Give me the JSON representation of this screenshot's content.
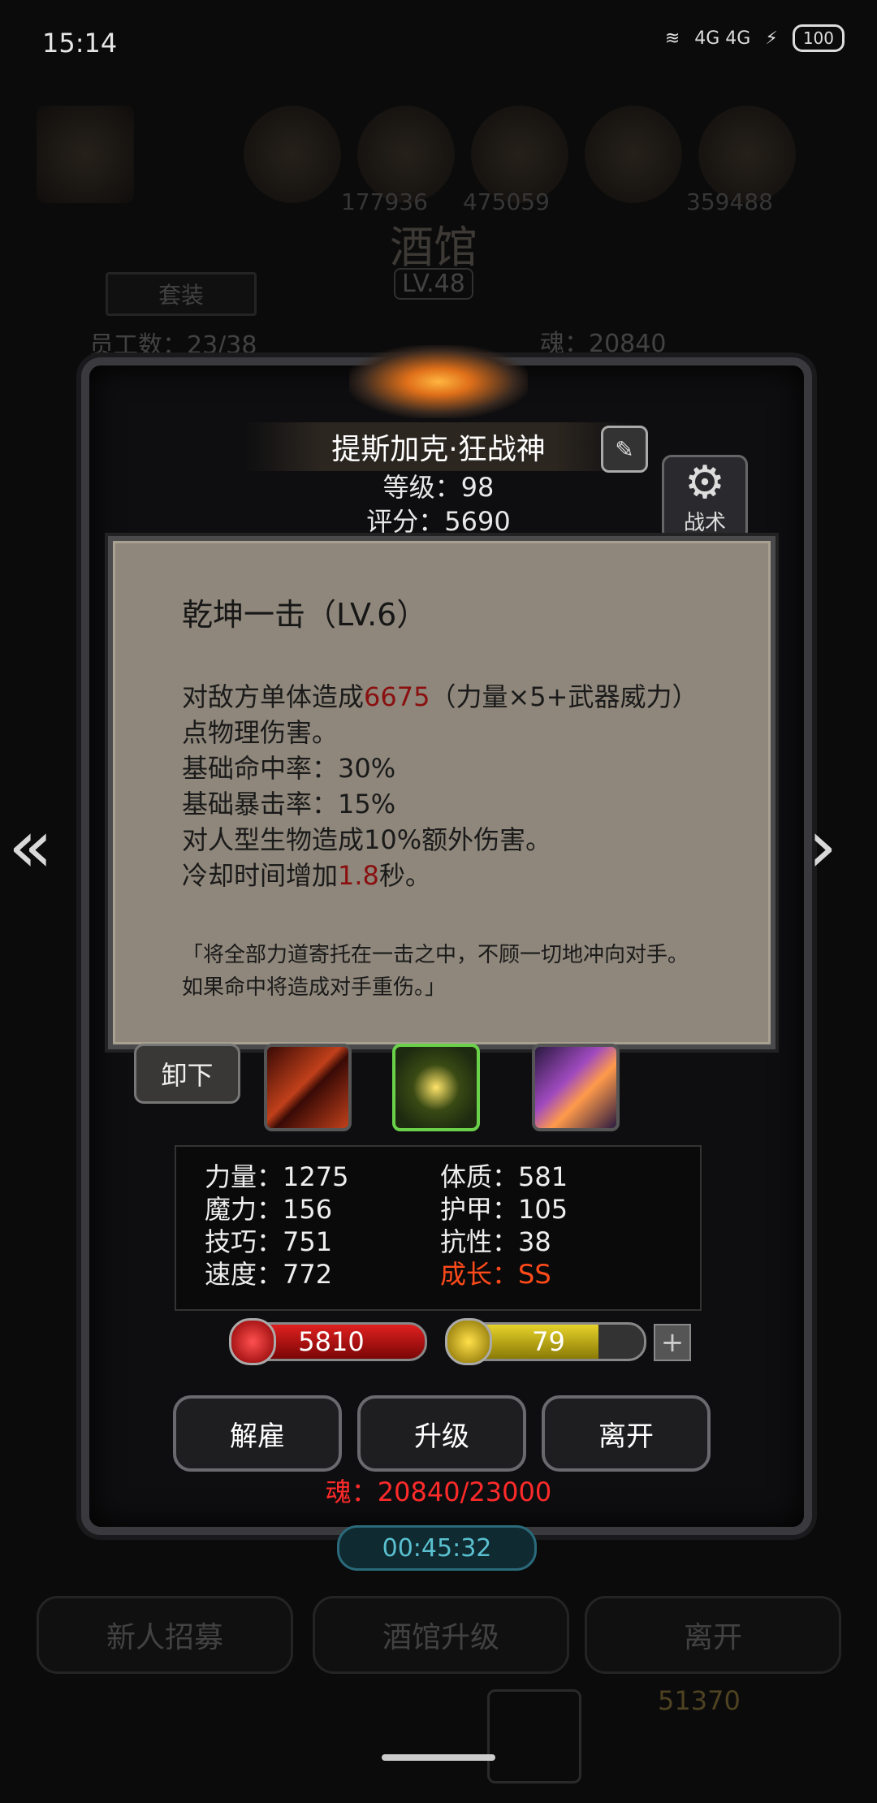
{
  "status_bar": {
    "time": "15:14",
    "network": "4G 4G",
    "battery": "100"
  },
  "background": {
    "title": "酒馆",
    "level": "LV.48",
    "tab_label": "套装",
    "soul_text": "魂：20840",
    "numbers": [
      "177936",
      "475059",
      "359488"
    ],
    "heroes_text": "员工数：23/38",
    "timer": "00:45:32",
    "buttons": [
      "新人招募",
      "酒馆升级",
      "离开"
    ],
    "currency": "51370"
  },
  "hero": {
    "name": "提斯加克·狂战神",
    "level_text": "等级：98",
    "score_text": "评分：5690",
    "tactics_label": "战术"
  },
  "skill_popup": {
    "title": "乾坤一击（LV.6）",
    "line1_pre": "对敌方单体造成",
    "line1_val": "6675",
    "line1_post": "（力量×5+武器威力）",
    "line2": "点物理伤害。",
    "line3": "基础命中率：30%",
    "line4": "基础暴击率：15%",
    "line5": "对人型生物造成10%额外伤害。",
    "line6_pre": "冷却时间增加",
    "line6_val": "1.8",
    "line6_post": "秒。",
    "quote1": "「将全部力道寄托在一击之中，不顾一切地冲向对手。",
    "quote2": "如果命中将造成对手重伤。」"
  },
  "skills": {
    "unequip_label": "卸下",
    "icons": [
      "slash-skill-icon",
      "lightning-skill-icon",
      "purple-skill-icon"
    ]
  },
  "stats": {
    "str": "力量：1275",
    "mag": "魔力：156",
    "skl": "技巧：751",
    "spd": "速度：772",
    "con": "体质：581",
    "arm": "护甲：105",
    "res": "抗性：38",
    "growth": "成长：SS"
  },
  "bars": {
    "hp": "5810",
    "energy": "79",
    "energy_fill": 0.76
  },
  "actions": {
    "fire": "解雇",
    "upgrade": "升级",
    "leave": "离开"
  },
  "soul": "魂：20840/23000",
  "colors": {
    "accent_red": "#ff2a2a",
    "growth": "#ff4a1a",
    "popup_bg": "#8f877b"
  }
}
